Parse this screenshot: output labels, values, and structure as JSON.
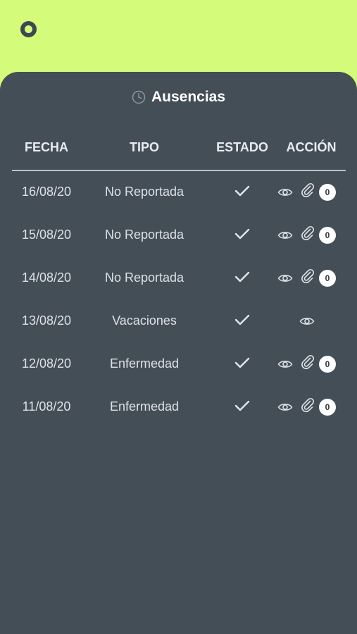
{
  "header": {
    "title": "Ausencias",
    "icons": {
      "menu": "circle-menu-icon",
      "title": "clock-icon"
    }
  },
  "table": {
    "columns": [
      "FECHA",
      "TIPO",
      "ESTADO",
      "ACCIÓN"
    ],
    "rows": [
      {
        "fecha": "16/08/20",
        "tipo": "No Reportada",
        "estado": "approved-check-icon",
        "attachment_count": "0",
        "has_attachments": true
      },
      {
        "fecha": "15/08/20",
        "tipo": "No Reportada",
        "estado": "approved-check-icon",
        "attachment_count": "0",
        "has_attachments": true
      },
      {
        "fecha": "14/08/20",
        "tipo": "No Reportada",
        "estado": "approved-check-icon",
        "attachment_count": "0",
        "has_attachments": true
      },
      {
        "fecha": "13/08/20",
        "tipo": "Vacaciones",
        "estado": "approved-check-icon",
        "attachment_count": null,
        "has_attachments": false
      },
      {
        "fecha": "12/08/20",
        "tipo": "Enfermedad",
        "estado": "approved-check-icon",
        "attachment_count": "0",
        "has_attachments": true
      },
      {
        "fecha": "11/08/20",
        "tipo": "Enfermedad",
        "estado": "approved-check-icon",
        "attachment_count": "0",
        "has_attachments": true
      }
    ]
  },
  "colors": {
    "background": "#d4fb79",
    "panel": "#444e57",
    "text": "#dde1e5",
    "badge": "#ffffff"
  }
}
